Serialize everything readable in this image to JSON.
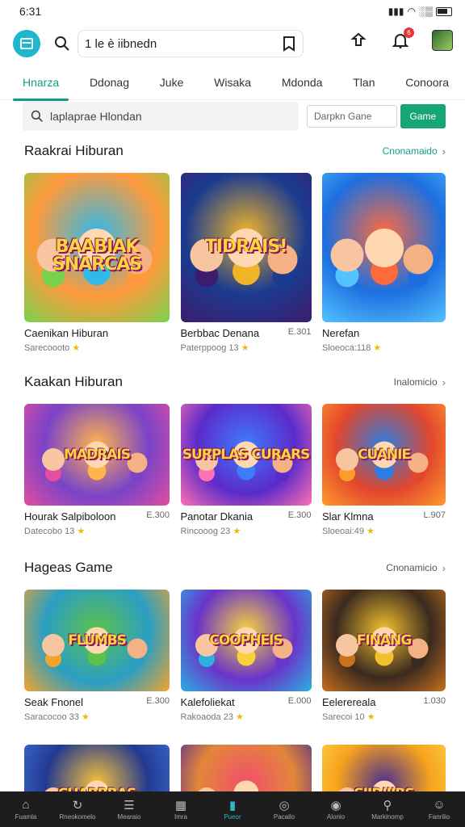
{
  "status": {
    "time": "6:31",
    "indicator": "░▒"
  },
  "header": {
    "search_value": "1 le è iibnedn",
    "notification_count": "6"
  },
  "tabs": [
    {
      "label": "Hnarza",
      "active": true
    },
    {
      "label": "Ddonag"
    },
    {
      "label": "Juke"
    },
    {
      "label": "Wisaka"
    },
    {
      "label": "Mdonda"
    },
    {
      "label": "Tlan"
    },
    {
      "label": "Conoora"
    }
  ],
  "search": {
    "placeholder": "laplaprae Hlondan",
    "game_field": "Darpkn Gane",
    "button": "Game"
  },
  "sections": [
    {
      "title": "Raakrai Hiburan",
      "more": "Cnonamaido",
      "cards": [
        {
          "name": "Caenikan Hiburan",
          "price": "",
          "sub": "Sarecoooto",
          "art_title": "BAABIAK SNARCAS",
          "colors": [
            "#ff9a3c",
            "#7ad14e",
            "#2fb9e8"
          ]
        },
        {
          "name": "Berbbac Denana",
          "price": "E.301",
          "sub": "Paterppoog 13",
          "art_title": "TIDRAIS!",
          "colors": [
            "#1b3b8f",
            "#3c1c6e",
            "#f0b429"
          ]
        },
        {
          "name": "Nerefan",
          "price": "",
          "sub": "Sloeoca:118",
          "art_title": "",
          "colors": [
            "#1d6fe0",
            "#53c3ff",
            "#ff6a3d"
          ]
        }
      ]
    },
    {
      "title": "Kaakan Hiburan",
      "more": "Inalomicio",
      "cards": [
        {
          "name": "Hourak Salpiboloon",
          "price": "E.300",
          "sub": "Datecobo 13",
          "art_title": "MADRAIS",
          "colors": [
            "#7a43c8",
            "#e24ea0",
            "#ffb54c"
          ]
        },
        {
          "name": "Panotar Dkania",
          "price": "E.300",
          "sub": "Rincooog 23",
          "art_title": "SURPLAS CURARS",
          "colors": [
            "#5b2bc9",
            "#ff6fb1",
            "#3f7bff"
          ]
        },
        {
          "name": "Slar Klmna",
          "price": "L.907",
          "sub": "Sloeoai:49",
          "art_title": "CUANIE",
          "colors": [
            "#e2472d",
            "#ff9c2b",
            "#2d7de0"
          ]
        }
      ]
    },
    {
      "title": "Hageas Game",
      "more": "Cnonamicio",
      "cards": [
        {
          "name": "Seak Fnonel",
          "price": "E.300",
          "sub": "Saracocoo 33",
          "art_title": "FLUMBS",
          "colors": [
            "#2a9ec4",
            "#f3a52b",
            "#5ec14a"
          ]
        },
        {
          "name": "Kalefoliekat",
          "price": "E.000",
          "sub": "Rakoaoda 23",
          "art_title": "COOPHEIS",
          "colors": [
            "#6a34c9",
            "#2bb0e0",
            "#f8d23c"
          ]
        },
        {
          "name": "Eelerereala",
          "price": "1.030",
          "sub": "Sarecoi 10",
          "art_title": "FINANG",
          "colors": [
            "#3a2a1f",
            "#c8711e",
            "#f2c12e"
          ]
        }
      ]
    },
    {
      "cards": [
        {
          "art_title": "CHARBRAS SPONGORS",
          "colors": [
            "#233a8f",
            "#3c6fd6",
            "#f8c23a"
          ]
        },
        {
          "art_title": "",
          "colors": [
            "#e3863a",
            "#4e2c8f",
            "#f04f6b"
          ]
        },
        {
          "art_title": "SIIDIIIRS",
          "colors": [
            "#f7a21d",
            "#ffd447",
            "#4b2f8f"
          ]
        }
      ]
    }
  ],
  "bottom_nav": [
    {
      "label": "Fuamla"
    },
    {
      "label": "Rneokomelo"
    },
    {
      "label": "Mearaio"
    },
    {
      "label": "Imra"
    },
    {
      "label": "Pueor",
      "active": true
    },
    {
      "label": "Pacailo"
    },
    {
      "label": "Alonio"
    },
    {
      "label": "Markinomp"
    },
    {
      "label": "Fanrilio"
    }
  ]
}
